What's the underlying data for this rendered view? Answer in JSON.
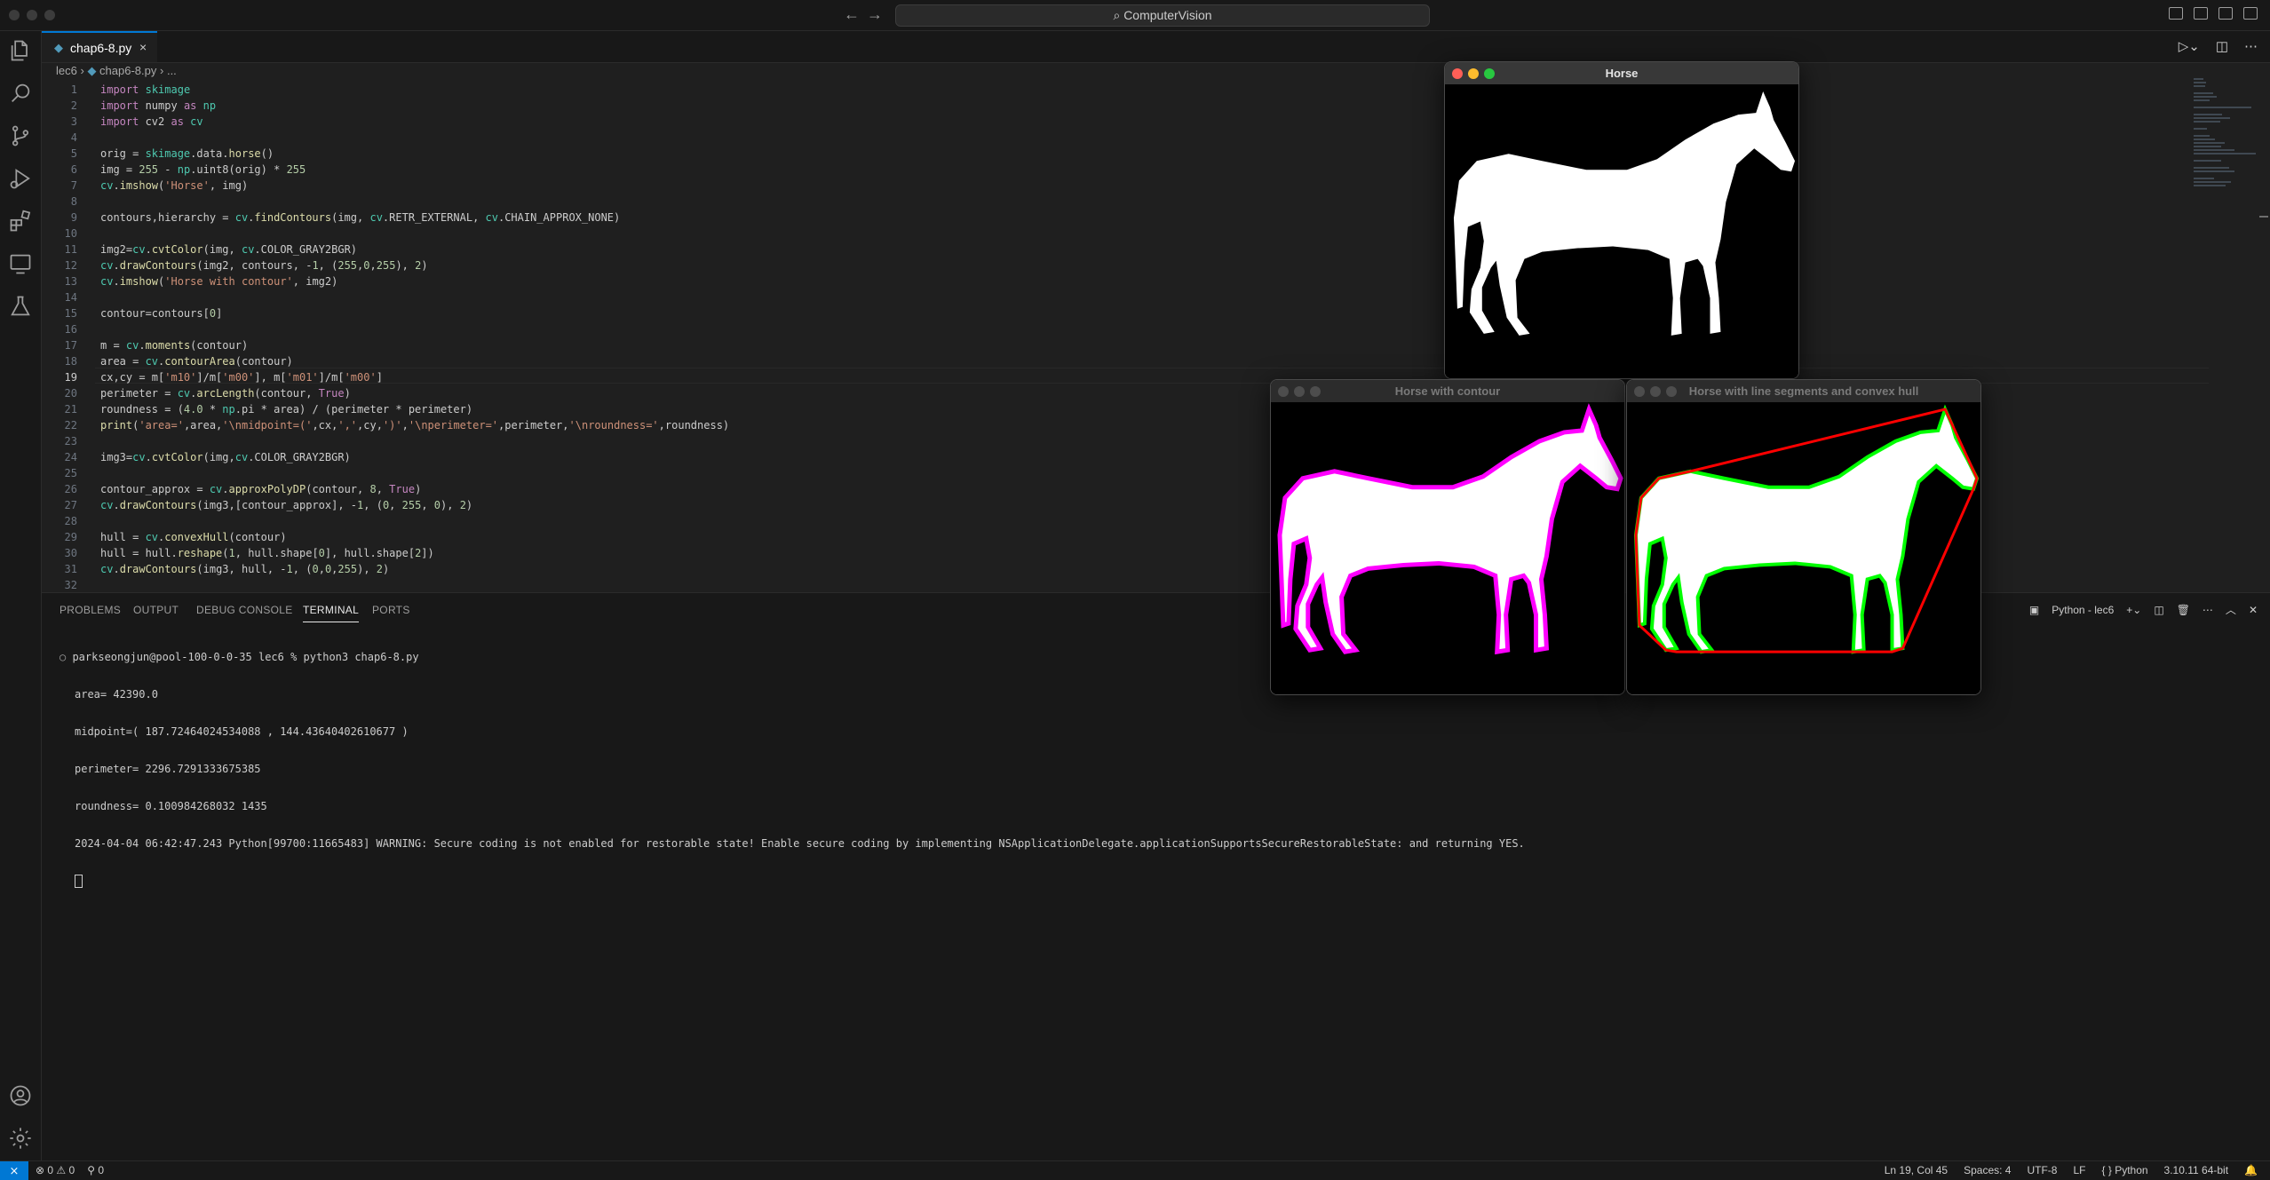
{
  "window": {
    "search_text": "ComputerVision"
  },
  "tab": {
    "filename": "chap6-8.py",
    "close": "×"
  },
  "breadcrumb": {
    "folder": "lec6",
    "file": "chap6-8.py",
    "more": "..."
  },
  "code_lines": [
    {
      "n": "1",
      "t": "import skimage"
    },
    {
      "n": "2",
      "t": "import numpy as np"
    },
    {
      "n": "3",
      "t": "import cv2 as cv"
    },
    {
      "n": "4",
      "t": ""
    },
    {
      "n": "5",
      "t": "orig = skimage.data.horse()"
    },
    {
      "n": "6",
      "t": "img = 255 - np.uint8(orig) * 255"
    },
    {
      "n": "7",
      "t": "cv.imshow('Horse', img)"
    },
    {
      "n": "8",
      "t": ""
    },
    {
      "n": "9",
      "t": "contours,hierarchy = cv.findContours(img, cv.RETR_EXTERNAL, cv.CHAIN_APPROX_NONE)"
    },
    {
      "n": "10",
      "t": ""
    },
    {
      "n": "11",
      "t": "img2=cv.cvtColor(img, cv.COLOR_GRAY2BGR)"
    },
    {
      "n": "12",
      "t": "cv.drawContours(img2, contours, -1, (255,0,255), 2)"
    },
    {
      "n": "13",
      "t": "cv.imshow('Horse with contour', img2)"
    },
    {
      "n": "14",
      "t": ""
    },
    {
      "n": "15",
      "t": "contour=contours[0]"
    },
    {
      "n": "16",
      "t": ""
    },
    {
      "n": "17",
      "t": "m = cv.moments(contour)"
    },
    {
      "n": "18",
      "t": "area = cv.contourArea(contour)"
    },
    {
      "n": "19",
      "t": "cx,cy = m['m10']/m['m00'], m['m01']/m['m00']"
    },
    {
      "n": "20",
      "t": "perimeter = cv.arcLength(contour, True)"
    },
    {
      "n": "21",
      "t": "roundness = (4.0 * np.pi * area) / (perimeter * perimeter)"
    },
    {
      "n": "22",
      "t": "print('area=',area,'\\nmidpoint=(',cx,',',cy,')','\\nperimeter=',perimeter,'\\nroundness=',roundness)"
    },
    {
      "n": "23",
      "t": ""
    },
    {
      "n": "24",
      "t": "img3=cv.cvtColor(img,cv.COLOR_GRAY2BGR)"
    },
    {
      "n": "25",
      "t": ""
    },
    {
      "n": "26",
      "t": "contour_approx = cv.approxPolyDP(contour, 8, True)"
    },
    {
      "n": "27",
      "t": "cv.drawContours(img3,[contour_approx], -1, (0, 255, 0), 2)"
    },
    {
      "n": "28",
      "t": ""
    },
    {
      "n": "29",
      "t": "hull = cv.convexHull(contour)"
    },
    {
      "n": "30",
      "t": "hull = hull.reshape(1, hull.shape[0], hull.shape[2])"
    },
    {
      "n": "31",
      "t": "cv.drawContours(img3, hull, -1, (0,0,255), 2)"
    },
    {
      "n": "32",
      "t": ""
    }
  ],
  "panel_tabs": [
    "PROBLEMS",
    "OUTPUT",
    "DEBUG CONSOLE",
    "TERMINAL",
    "PORTS"
  ],
  "terminal_label": "Python - lec6",
  "terminal": {
    "prompt": "parkseongjun@pool-100-0-0-35 lec6 % python3 chap6-8.py",
    "lines": [
      "area= 42390.0",
      "midpoint=( 187.72464024534088 , 144.43640402610677 )",
      "perimeter= 2296.7291333675385",
      "roundness= 0.100984268032 1435",
      "2024-04-04 06:42:47.243 Python[99700:11665483] WARNING: Secure coding is not enabled for restorable state! Enable secure coding by implementing NSApplicationDelegate.applicationSupportsSecureRestorableState: and returning YES."
    ]
  },
  "cv_windows": {
    "horse": "Horse",
    "contour": "Horse with contour",
    "hull": "Horse with line segments and convex hull"
  },
  "status": {
    "errors": "0",
    "warnings": "0",
    "ports": "0",
    "position": "Ln 19, Col 45",
    "spaces": "Spaces: 4",
    "encoding": "UTF-8",
    "eol": "LF",
    "language": "Python",
    "interpreter": "3.10.11 64-bit"
  },
  "colors": {
    "accent": "#0078d4",
    "contour": "#ff00ff",
    "approx": "#00ff00",
    "hull": "#ff0000"
  }
}
